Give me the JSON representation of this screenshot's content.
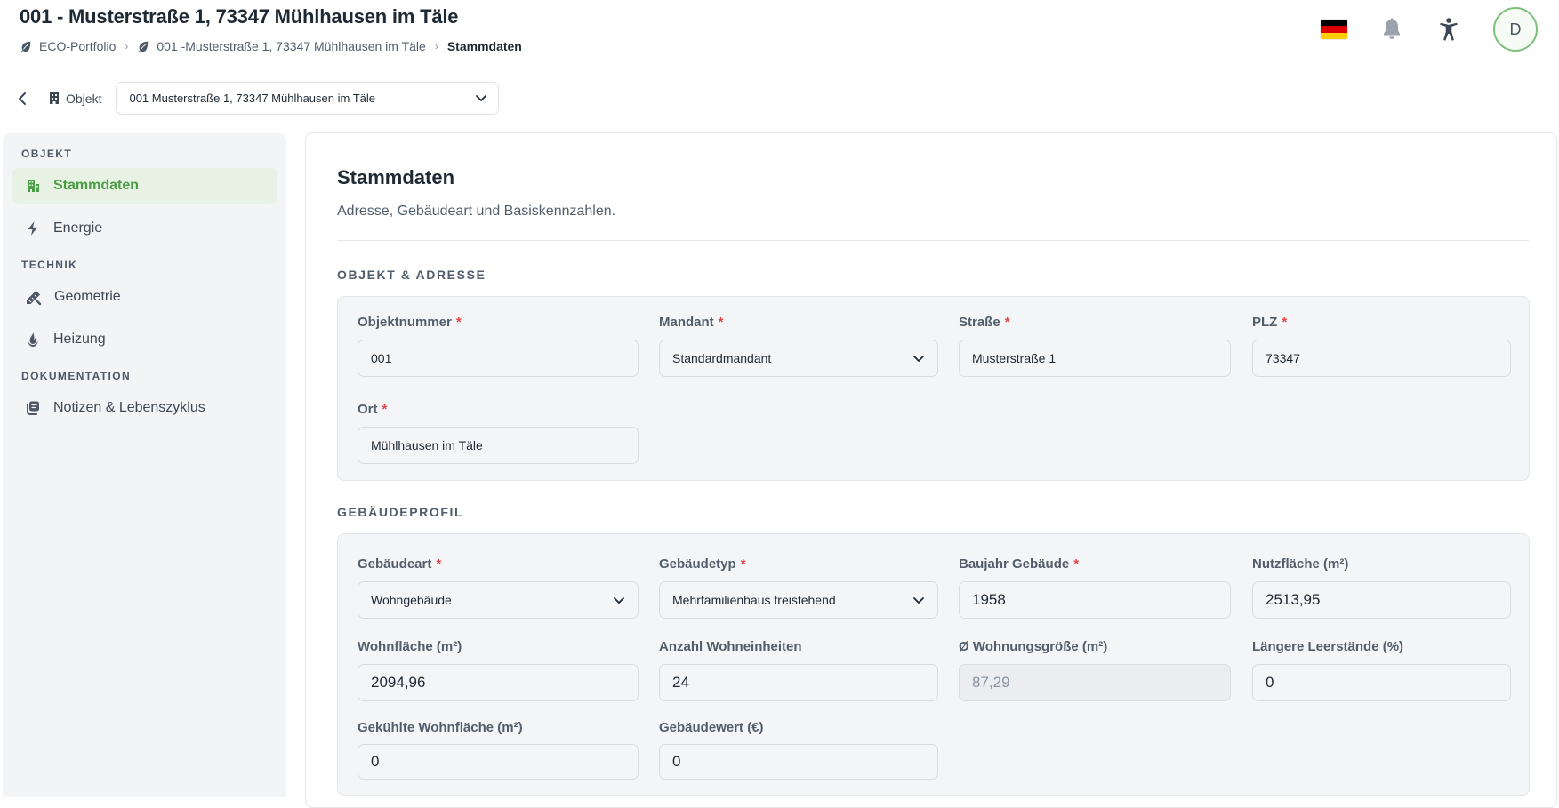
{
  "header": {
    "title": "001 - Musterstraße 1, 73347 Mühlhausen im Täle",
    "breadcrumb": [
      {
        "label": "ECO-Portfolio",
        "icon": "leaf-icon"
      },
      {
        "label": "001 -Musterstraße 1, 73347 Mühlhausen im Täle",
        "icon": "leaf-icon"
      },
      {
        "label": "Stammdaten"
      }
    ],
    "avatar_initial": "D",
    "flag_colors": [
      "#000000",
      "#dd0000",
      "#ffce00"
    ]
  },
  "object_selector": {
    "label": "Objekt",
    "value": "001 Musterstraße 1, 73347 Mühlhausen im Täle"
  },
  "sidebar": {
    "sections": [
      {
        "title": "OBJEKT",
        "items": [
          {
            "label": "Stammdaten",
            "icon": "building-icon",
            "active": true
          },
          {
            "label": "Energie",
            "icon": "bolt-icon",
            "active": false
          }
        ]
      },
      {
        "title": "TECHNIK",
        "items": [
          {
            "label": "Geometrie",
            "icon": "ruler-pencil-icon",
            "active": false
          },
          {
            "label": "Heizung",
            "icon": "flame-icon",
            "active": false
          }
        ]
      },
      {
        "title": "DOKUMENTATION",
        "items": [
          {
            "label": "Notizen & Lebenszyklus",
            "icon": "notes-icon",
            "active": false
          }
        ]
      }
    ]
  },
  "main": {
    "title": "Stammdaten",
    "subtitle": "Adresse, Gebäudeart und Basiskennzahlen.",
    "section_address": {
      "title": "OBJEKT & ADRESSE",
      "fields": {
        "objektnummer": {
          "label": "Objektnummer",
          "value": "001",
          "required": "*"
        },
        "mandant": {
          "label": "Mandant",
          "value": "Standardmandant",
          "required": "*"
        },
        "strasse": {
          "label": "Straße",
          "value": "Musterstraße 1",
          "required": "*"
        },
        "plz": {
          "label": "PLZ",
          "value": "73347",
          "required": "*"
        },
        "ort": {
          "label": "Ort",
          "value": "Mühlhausen im Täle",
          "required": "*"
        }
      }
    },
    "section_profile": {
      "title": "GEBÄUDEPROFIL",
      "fields": {
        "gebaeudeart": {
          "label": "Gebäudeart",
          "value": "Wohngebäude",
          "required": "*"
        },
        "gebaeudetyp": {
          "label": "Gebäudetyp",
          "value": "Mehrfamilienhaus freistehend",
          "required": "*"
        },
        "baujahr": {
          "label": "Baujahr Gebäude",
          "value": "1958",
          "required": "*"
        },
        "nutzflaeche": {
          "label": "Nutzfläche (m²)",
          "value": "2513,95"
        },
        "wohnflaeche": {
          "label": "Wohnfläche (m²)",
          "value": "2094,96"
        },
        "wohneinheiten": {
          "label": "Anzahl Wohneinheiten",
          "value": "24"
        },
        "wohnungsgroesse": {
          "label": "Ø Wohnungsgröße (m²)",
          "value": "87,29"
        },
        "leerstaende": {
          "label": "Längere Leerstände (%)",
          "value": "0"
        },
        "gekuehlte_wohnflaeche": {
          "label": "Gekühlte Wohnfläche (m²)",
          "value": "0"
        },
        "gebaeudewert": {
          "label": "Gebäudewert (€)",
          "value": "0"
        }
      }
    }
  },
  "colors": {
    "accent_green": "#4a9c45",
    "active_bg": "#e7f2e4",
    "required_red": "#e04545"
  }
}
